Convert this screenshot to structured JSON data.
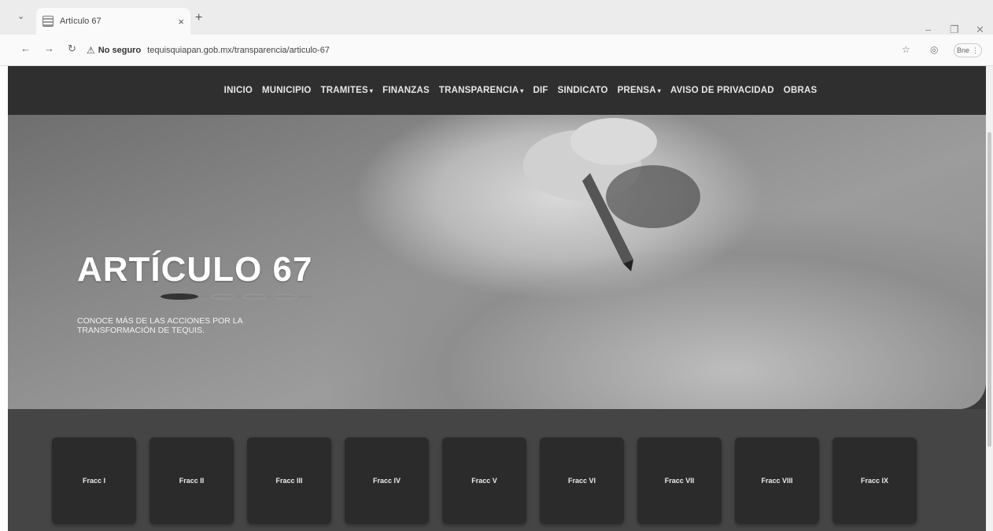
{
  "browser": {
    "tab_title": "Artículo 67",
    "tab_close": "×",
    "new_tab": "+",
    "security_label": "No seguro",
    "url": "tequisquiapan.gob.mx/transparencia/articulo-67",
    "profile_label": "Bne",
    "icons": [
      "back-icon",
      "forward-icon",
      "reload-icon",
      "warning-icon",
      "star-icon",
      "extension-icon",
      "menu-icon"
    ]
  },
  "nav": {
    "items": [
      {
        "label": "INICIO",
        "dropdown": false
      },
      {
        "label": "MUNICIPIO",
        "dropdown": false
      },
      {
        "label": "TRAMITES",
        "dropdown": true
      },
      {
        "label": "FINANZAS",
        "dropdown": false
      },
      {
        "label": "TRANSPARENCIA",
        "dropdown": true
      },
      {
        "label": "DIF",
        "dropdown": false
      },
      {
        "label": "SINDICATO",
        "dropdown": false
      },
      {
        "label": "PRENSA",
        "dropdown": true
      },
      {
        "label": "AVISO DE PRIVACIDAD",
        "dropdown": false
      },
      {
        "label": "OBRAS",
        "dropdown": false
      }
    ]
  },
  "hero": {
    "title": "ARTÍCULO 67",
    "subtitle": "CONOCE MÁS DE LAS ACCIONES POR LA TRANSFORMACIÓN DE TEQUIS."
  },
  "fracciones": [
    "Fracc I",
    "Fracc II",
    "Fracc III",
    "Fracc IV",
    "Fracc V",
    "Fracc VI",
    "Fracc VII",
    "Fracc VIII",
    "Fracc IX"
  ]
}
